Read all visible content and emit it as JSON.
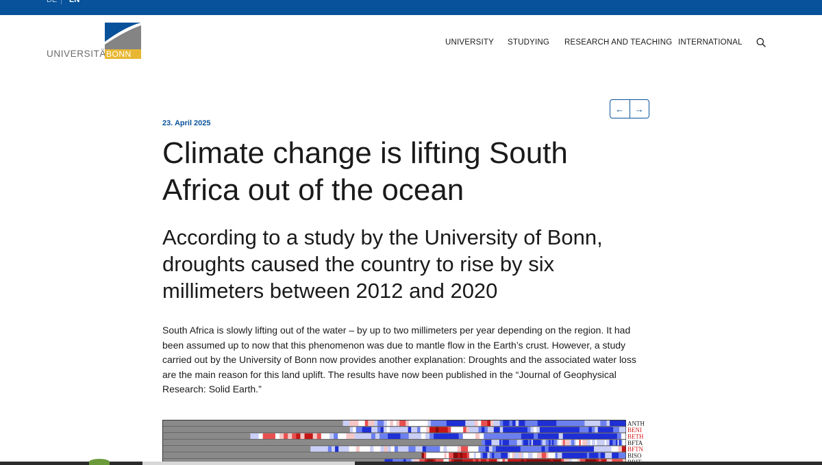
{
  "topbar": {
    "lang_de": "DE",
    "lang_en": "EN",
    "color": "#07529a"
  },
  "logo": {
    "university_text": "UNIVERSITÄT",
    "bonn_text": "BONN",
    "accent_gold": "#e8b732",
    "accent_grey": "#848484",
    "accent_blue": "#07529a"
  },
  "nav": {
    "items": [
      "UNIVERSITY",
      "STUDYING",
      "RESEARCH AND TEACHING",
      "INTERNATIONAL"
    ],
    "search_icon": "search-icon"
  },
  "pager": {
    "prev_icon": "arrow-left-icon",
    "next_icon": "arrow-right-icon",
    "prev_label": "←",
    "next_label": "→"
  },
  "article": {
    "date": "23. April 2025",
    "title": "Climate change is lifting South Africa out of the ocean",
    "subtitle": "According to a study by the University of Bonn, droughts caused the country to rise by six millimeters between 2012 and 2020",
    "lead": "South Africa is slowly lifting out of the water – by up to two millimeters per year depending on the region. It had been assumed up to now that this phenomenon was due to mantle flow in the Earth’s crust. However, a study carried out by the University of Bonn now provides another explanation: Droughts and the associated water loss are the main reason for this land uplift. The results have now been published in the “Journal of Geophysical Research: Solid Earth.”"
  },
  "figure": {
    "rows": [
      {
        "label": "ANTH",
        "label_color": "#1a1a1a",
        "start": 0.39
      },
      {
        "label": "BENI",
        "label_color": "#d11a1a",
        "start": 0.405
      },
      {
        "label": "BETH",
        "label_color": "#d11a1a",
        "start": 0.19
      },
      {
        "label": "BFTA",
        "label_color": "#1a1a1a",
        "start": 0.69
      },
      {
        "label": "BFTN",
        "label_color": "#d11a1a",
        "start": 0.32
      },
      {
        "label": "BISO",
        "label_color": "#1a1a1a",
        "start": 0.56
      },
      {
        "label": "BRIT",
        "label_color": "#1a1a1a",
        "start": 0.48
      }
    ]
  }
}
